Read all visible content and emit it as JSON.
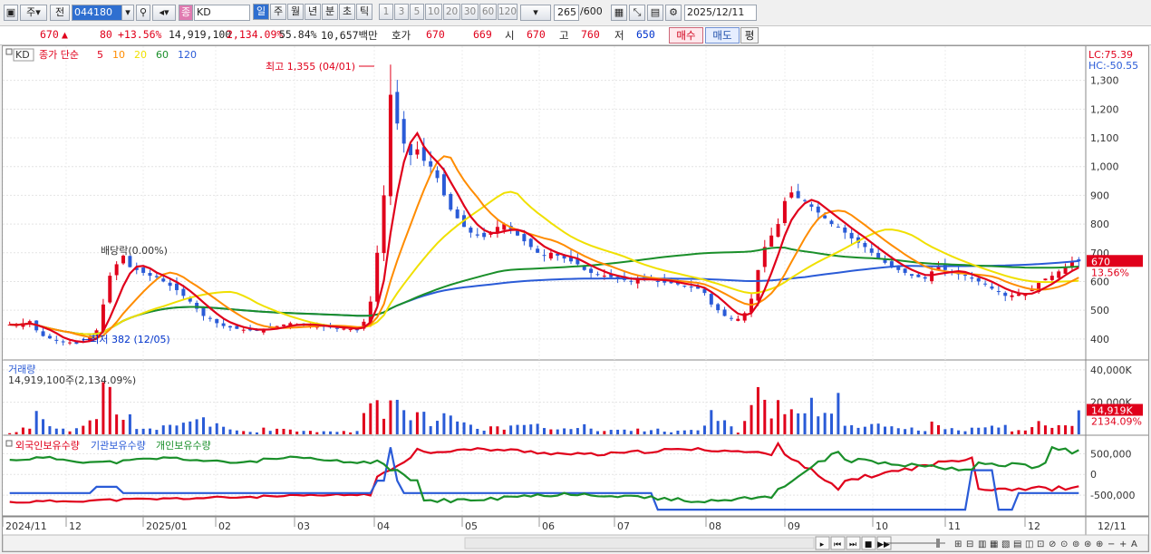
{
  "toolbar": {
    "market_kind": "주",
    "prev_label": "전",
    "code": "044180",
    "stock_name": "KD",
    "period_tabs": [
      "일",
      "주",
      "월",
      "년",
      "분",
      "초",
      "틱"
    ],
    "active_period": "일",
    "ticks": [
      "1",
      "3",
      "5",
      "10",
      "20",
      "30",
      "60",
      "120"
    ],
    "count": "265",
    "max_count": "/600",
    "date": "2025/12/11",
    "tag": "종"
  },
  "quote": {
    "price": "670",
    "change": "80",
    "change_pct": "+13.56%",
    "volume": "14,919,100",
    "volume_pct": "2,134.09%",
    "turnover": "55.84%",
    "amount": "10,657백만",
    "ask_label": "호가",
    "ask": "670",
    "bid": "669",
    "open_label": "시",
    "open": "670",
    "high_label": "고",
    "high": "760",
    "low_label": "저",
    "low": "650",
    "buy_button": "매수",
    "sell_button": "매도",
    "eval_button": "평"
  },
  "price_panel": {
    "tag": "KD",
    "legend_prefix": "종가 단순",
    "ma": [
      {
        "period": "5",
        "color": "#e0001b"
      },
      {
        "period": "10",
        "color": "#ff8c00"
      },
      {
        "period": "20",
        "color": "#f0e000"
      },
      {
        "period": "60",
        "color": "#1a8f2a"
      },
      {
        "period": "120",
        "color": "#2a5bd7"
      }
    ],
    "lc_label": "LC:75.39",
    "hc_label": "HC:-50.55",
    "annotation_high": "최고 1,355 (04/01)",
    "annotation_low": "최저 382 (12/05)",
    "annotation_div": "배당락(0.00%)",
    "last_price": "670",
    "last_pct": "13.56%"
  },
  "volume_panel": {
    "title": "거래량",
    "subtitle": "14,919,100주(2,134.09%)",
    "last_label": "14,919K",
    "last_pct": "2134.09%"
  },
  "holdings_panel": {
    "labels": [
      {
        "text": "외국인보유수량",
        "color": "#e0001b"
      },
      {
        "text": "기관보유수량",
        "color": "#2a5bd7"
      },
      {
        "text": "개인보유수량",
        "color": "#1a8f2a"
      }
    ]
  },
  "x_axis": [
    "2024/11",
    "12",
    "2025/01",
    "02",
    "03",
    "04",
    "05",
    "06",
    "07",
    "08",
    "09",
    "10",
    "11",
    "12",
    "12/11"
  ],
  "chart_data": [
    {
      "type": "candlestick",
      "y_ticks": [
        400,
        500,
        600,
        700,
        800,
        900,
        1000,
        1100,
        1200,
        1300
      ],
      "ylim": [
        330,
        1400
      ],
      "close": [
        450,
        448,
        455,
        462,
        430,
        410,
        402,
        396,
        390,
        388,
        383,
        392,
        410,
        430,
        520,
        620,
        660,
        690,
        650,
        640,
        630,
        620,
        615,
        600,
        585,
        570,
        550,
        530,
        505,
        480,
        470,
        455,
        445,
        440,
        435,
        432,
        430,
        428,
        436,
        440,
        445,
        450,
        455,
        452,
        448,
        446,
        444,
        442,
        440,
        438,
        436,
        434,
        430,
        460,
        530,
        700,
        900,
        1250,
        1150,
        1080,
        1040,
        1060,
        1020,
        1000,
        960,
        900,
        850,
        820,
        790,
        770,
        760,
        755,
        770,
        790,
        800,
        780,
        760,
        740,
        720,
        700,
        690,
        700,
        690,
        680,
        670,
        660,
        640,
        630,
        625,
        620,
        615,
        610,
        605,
        600,
        610,
        612,
        608,
        600,
        596,
        594,
        590,
        585,
        580,
        575,
        560,
        520,
        500,
        480,
        470,
        470,
        490,
        540,
        640,
        720,
        760,
        800,
        880,
        910,
        890,
        880,
        860,
        840,
        820,
        800,
        790,
        770,
        750,
        735,
        720,
        700,
        680,
        665,
        650,
        640,
        630,
        620,
        615,
        610,
        635,
        650,
        640,
        630,
        625,
        620,
        610,
        600,
        590,
        575,
        565,
        550,
        552,
        556,
        560,
        572,
        595,
        610,
        620,
        635,
        650,
        668,
        670
      ],
      "ma_x_note": "",
      "volume_ticks": [
        "20,000K",
        "40,000K"
      ],
      "holdings_ticks": [
        "500,000",
        "0",
        "-500,000"
      ]
    }
  ]
}
